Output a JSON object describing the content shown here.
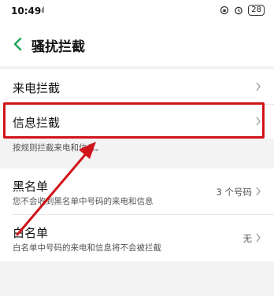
{
  "status_bar": {
    "time": "10:49",
    "signal": "ıl",
    "battery": "28"
  },
  "header": {
    "title": "骚扰拦截"
  },
  "settings": {
    "call_block": {
      "label": "来电拦截"
    },
    "sms_block": {
      "label": "信息拦截"
    },
    "hint": "按规则拦截来电和信息。"
  },
  "lists": {
    "blacklist": {
      "label": "黑名单",
      "desc": "您不会收到黑名单中号码的来电和信息",
      "value": "3 个号码"
    },
    "whitelist": {
      "label": "白名单",
      "desc": "白名单中号码的来电和信息将不会被拦截",
      "value": "无"
    }
  },
  "colors": {
    "highlight": "#d0141a",
    "accent_back": "#1aa35a"
  }
}
